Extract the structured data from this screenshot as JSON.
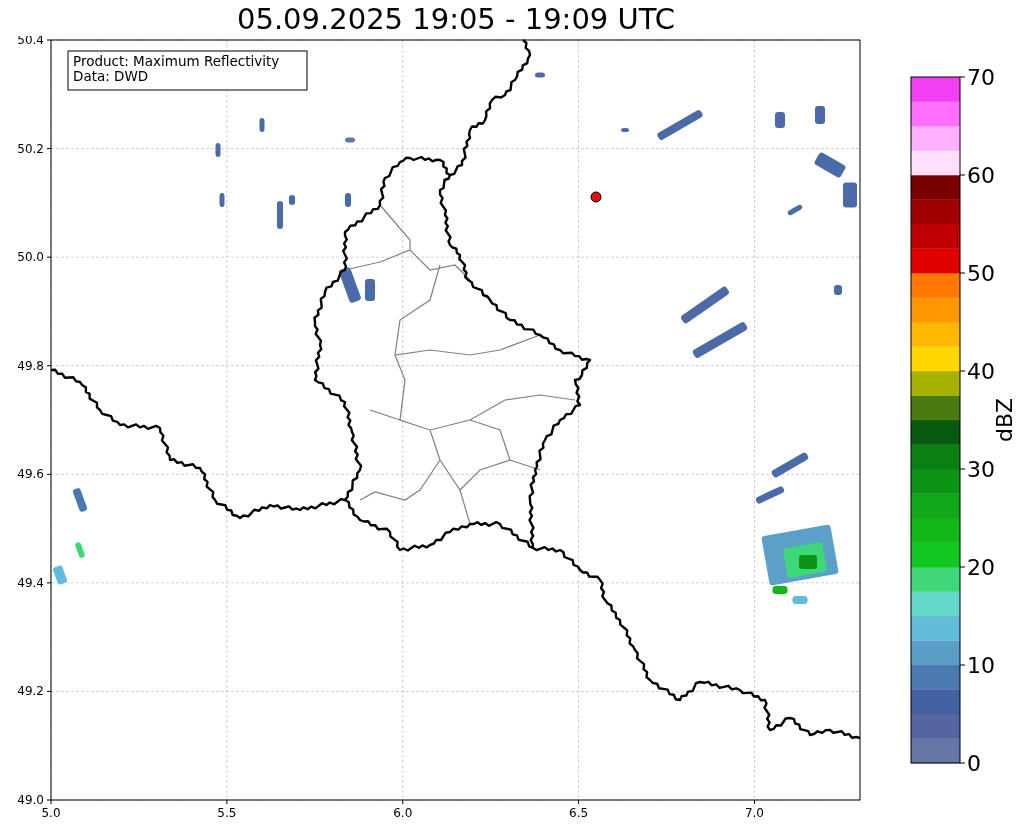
{
  "title": "05.09.2025 19:05 - 19:09 UTC",
  "legend": [
    "Product: Maximum Reflectivity",
    "Data: DWD"
  ],
  "x_axis": {
    "ticks": [
      "5.0",
      "5.5",
      "6.0",
      "6.5",
      "7.0"
    ]
  },
  "y_axis": {
    "ticks": [
      "50.4",
      "50.2",
      "50.0",
      "49.8",
      "49.6",
      "49.4",
      "49.2",
      "49.0"
    ]
  },
  "colorbar": {
    "label": "dBZ",
    "ticks": [
      "70",
      "60",
      "50",
      "40",
      "30",
      "20",
      "10",
      "0"
    ],
    "bands": [
      {
        "color": "#6576a6"
      },
      {
        "color": "#5466a2"
      },
      {
        "color": "#4360a0"
      },
      {
        "color": "#4a78b0"
      },
      {
        "color": "#5a9ec8"
      },
      {
        "color": "#60bcd8"
      },
      {
        "color": "#62d8c8"
      },
      {
        "color": "#3ed878"
      },
      {
        "color": "#10c820"
      },
      {
        "color": "#12b818"
      },
      {
        "color": "#10a818"
      },
      {
        "color": "#0c9414"
      },
      {
        "color": "#0a8012"
      },
      {
        "color": "#085a0e"
      },
      {
        "color": "#4a7a10"
      },
      {
        "color": "#a8b000"
      },
      {
        "color": "#ffd700"
      },
      {
        "color": "#ffb800"
      },
      {
        "color": "#ff9800"
      },
      {
        "color": "#ff7800"
      },
      {
        "color": "#e00000"
      },
      {
        "color": "#c00000"
      },
      {
        "color": "#a00000"
      },
      {
        "color": "#7a0000"
      },
      {
        "color": "#ffe0ff"
      },
      {
        "color": "#ffb0ff"
      },
      {
        "color": "#ff70ff"
      },
      {
        "color": "#f040f0"
      }
    ]
  }
}
